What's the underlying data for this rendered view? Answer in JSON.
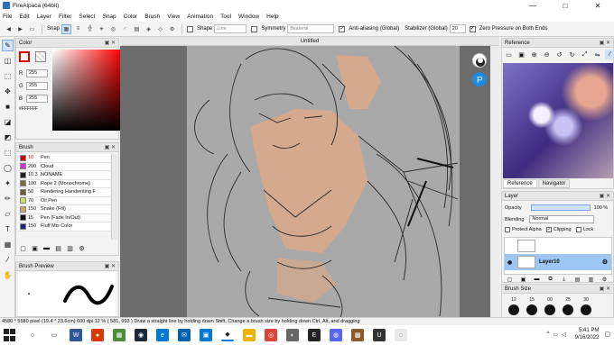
{
  "window": {
    "title": "FireAlpaca (64bit)",
    "controls": [
      "—",
      "□",
      "✕"
    ]
  },
  "menu": [
    "File",
    "Edit",
    "Layer",
    "Filter",
    "Select",
    "Snap",
    "Color",
    "Brush",
    "View",
    "Animation",
    "Tool",
    "Window",
    "Help"
  ],
  "toolbar": {
    "snap_label": "Snap",
    "shape_label": "Shape",
    "shape_value": "Line",
    "symmetry_label": "Symmetry",
    "symmetry_value": "Bilateral",
    "antialias_label": "Anti-aliasing (Global)",
    "stabilizer_label": "Stabilizer (Global)",
    "stabilizer_value": "20",
    "zero_pressure_label": "Zero Pressure on Both Ends"
  },
  "color_panel": {
    "title": "Color",
    "r_label": "R",
    "r": "255",
    "g_label": "G",
    "g": "255",
    "b_label": "B",
    "b": "255",
    "hex": "#FFFFFF"
  },
  "brush_panel": {
    "title": "Brush",
    "items": [
      {
        "size": "10",
        "name": "Pen",
        "color": "#d00000"
      },
      {
        "size": "200",
        "name": "Cloud",
        "color": "#cc33cc"
      },
      {
        "size": "10.3",
        "name": "NONAME",
        "color": "#222222"
      },
      {
        "size": "100",
        "name": "Rope 2 (Monochrome)",
        "color": "#7a6a3a"
      },
      {
        "size": "50",
        "name": "Rendering Handwriting F",
        "color": "#6b5a2e"
      },
      {
        "size": "70",
        "name": "Oil Pen",
        "color": "#c8e070"
      },
      {
        "size": "150",
        "name": "Snake (Fill)",
        "color": "#c9a86a"
      },
      {
        "size": "15",
        "name": "Pen (Fade In/Out)",
        "color": "#111111"
      },
      {
        "size": "150",
        "name": "Fluff Mix Color",
        "color": "#222288"
      }
    ]
  },
  "preview_panel": {
    "title": "Brush Preview"
  },
  "canvas": {
    "title": "Untitled"
  },
  "reference_panel": {
    "title": "Reference",
    "tabs": [
      "Reference",
      "Navigator"
    ]
  },
  "layer_panel": {
    "title": "Layer",
    "opacity_label": "Opacity",
    "opacity_value": "100 %",
    "blending_label": "Blending",
    "blending_value": "Normal",
    "protect_alpha": "Protect Alpha",
    "clipping": "Clipping",
    "lock": "Lock",
    "layers": [
      {
        "name": "Layer10"
      }
    ]
  },
  "brushsize_panel": {
    "title": "Brush Size",
    "sizes": [
      "12",
      "15",
      "00",
      "25",
      "30"
    ]
  },
  "statusbar": {
    "text": "4580 * 5580 pixel  (19.4 * 23.6cm)  600 dpi  12 %  ( 581, 993 )  Draw a straight line by holding down Shift, Change a brush size by holding down Ctrl, Alt, and dragging"
  },
  "taskbar": {
    "time": "5:41 PM",
    "date": "9/16/2022"
  }
}
